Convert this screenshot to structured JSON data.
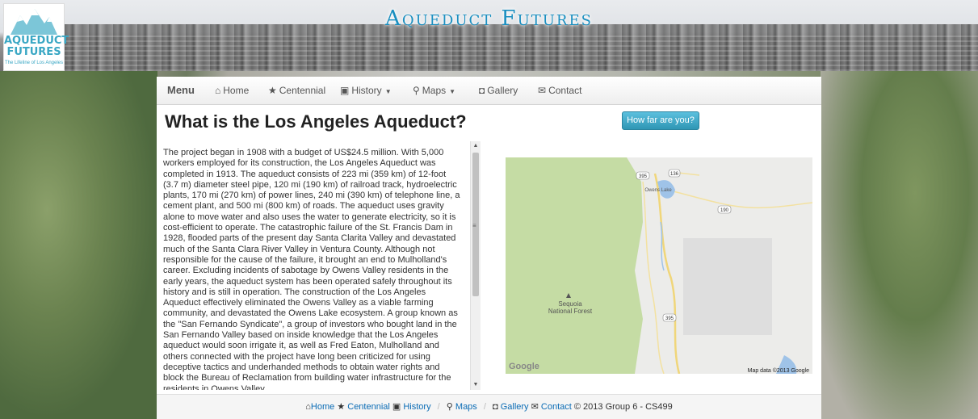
{
  "site": {
    "title": "Aqueduct Futures",
    "logo": {
      "line1": "AQUEDUCT",
      "line2": "FUTURES",
      "tagline": "The Lifeline of Los Angeles"
    }
  },
  "nav": {
    "brand": "Menu",
    "items": [
      {
        "label": "Home",
        "icon": "home-icon"
      },
      {
        "label": "Centennial",
        "icon": "star-icon"
      },
      {
        "label": "History",
        "icon": "picture-icon",
        "dropdown": true
      },
      {
        "label": "Maps",
        "icon": "map-marker-icon",
        "dropdown": true
      },
      {
        "label": "Gallery",
        "icon": "camera-icon"
      },
      {
        "label": "Contact",
        "icon": "envelope-icon"
      }
    ]
  },
  "main": {
    "heading": "What is the Los Angeles Aqueduct?",
    "cta_label": "How far are you?",
    "body_text": "The project began in 1908 with a budget of US$24.5 million. With 5,000 workers employed for its construction, the Los Angeles Aqueduct was completed in 1913. The aqueduct consists of 223 mi (359 km) of 12-foot (3.7 m) diameter steel pipe, 120 mi (190 km) of railroad track, hydroelectric plants, 170 mi (270 km) of power lines, 240 mi (390 km) of telephone line, a cement plant, and 500 mi (800 km) of roads. The aqueduct uses gravity alone to move water and also uses the water to generate electricity, so it is cost-efficient to operate. The catastrophic failure of the St. Francis Dam in 1928, flooded parts of the present day Santa Clarita Valley and devastated much of the Santa Clara River Valley in Ventura County. Although not responsible for the cause of the failure, it brought an end to Mulholland's career. Excluding incidents of sabotage by Owens Valley residents in the early years, the aqueduct system has been operated safely throughout its history and is still in operation. The construction of the Los Angeles Aqueduct effectively eliminated the Owens Valley as a viable farming community, and devastated the Owens Lake ecosystem. A group known as the \"San Fernando Syndicate\", a group of investors who bought land in the San Fernando Valley based on inside knowledge that the Los Angeles aqueduct would soon irrigate it, as well as Fred Eaton, Mulholland and others connected with the project have long been criticized for using deceptive tactics and underhanded methods to obtain water rights and block the Bureau of Reclamation from building water infrastructure for the residents in Owens Valley."
  },
  "map": {
    "labels": {
      "forest": "Sequoia National Forest",
      "lake": "Owens Lake",
      "hwy1": "395",
      "hwy2": "136",
      "hwy3": "190",
      "hwy4": "395"
    },
    "provider": "Google",
    "attribution": "Map data ©2013 Google"
  },
  "footer": {
    "links": [
      "Home",
      "Centennial",
      "History",
      "Maps",
      "Gallery",
      "Contact"
    ],
    "copyright": "© 2013 Group 6 - CS499"
  },
  "colors": {
    "title": "#1b8fc0",
    "button": "#2f96b4",
    "forest": "#c5dca4",
    "link": "#0b6cb5"
  }
}
